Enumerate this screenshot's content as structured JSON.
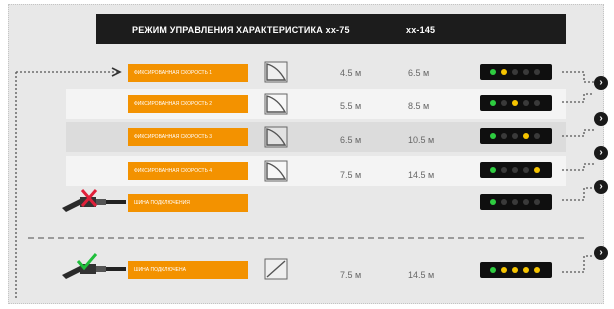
{
  "header": {
    "mode_label": "РЕЖИМ УПРАВЛЕНИЯ",
    "characteristic_label": "ХАРАКТЕРИСТИКА хх-75",
    "xx145_label": "хх-145"
  },
  "rows": [
    {
      "label": "фиксированная скорость 1",
      "v1": "4.5 м",
      "v2": "6.5 м",
      "leds": [
        "g",
        "y",
        "off",
        "off",
        "off"
      ]
    },
    {
      "label": "фиксированная скорость 2",
      "v1": "5.5 м",
      "v2": "8.5 м",
      "leds": [
        "g",
        "off",
        "y",
        "off",
        "off"
      ]
    },
    {
      "label": "фиксированная скорость 3",
      "v1": "6.5 м",
      "v2": "10.5 м",
      "leds": [
        "g",
        "off",
        "off",
        "y",
        "off"
      ]
    },
    {
      "label": "фиксированная скорость 4",
      "v1": "7.5 м",
      "v2": "14.5 м",
      "leds": [
        "g",
        "off",
        "off",
        "off",
        "y"
      ]
    },
    {
      "label": "шина подключения",
      "v1": "",
      "v2": "",
      "leds": [
        "g",
        "off",
        "off",
        "off",
        "off"
      ]
    }
  ],
  "connected_row": {
    "label": "шина подключена",
    "v1": "7.5 м",
    "v2": "14.5 м",
    "leds": [
      "g",
      "y",
      "y",
      "y",
      "y"
    ]
  },
  "colors": {
    "accent": "#f39200",
    "led_green": "#2ecc40",
    "led_yellow": "#f5c400",
    "header_bg": "#1c1c1c"
  },
  "icons": [
    "curve-icon",
    "linear-curve-icon",
    "chevron-right-icon",
    "cable-disconnected-icon",
    "cable-connected-icon",
    "cross-icon",
    "check-icon"
  ]
}
